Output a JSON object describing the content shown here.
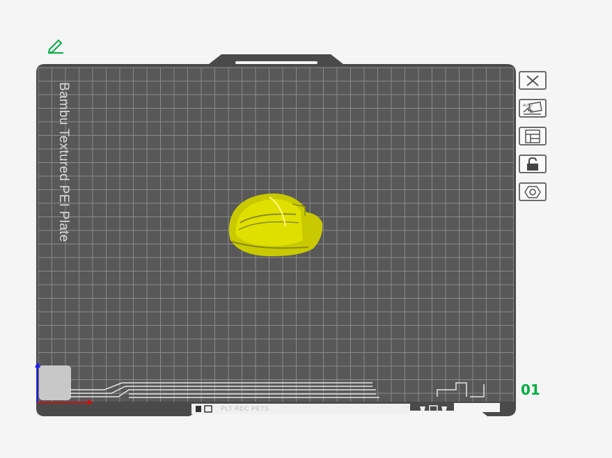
{
  "plate": {
    "name": "Bambu Textured PEI Plate",
    "index": "01",
    "bed_color": "#585858",
    "grid_color": "#8a8a8a",
    "accent_color": "#00ae42"
  },
  "toolbar": {
    "buttons": [
      {
        "name": "close-plate-button",
        "icon": "close-icon"
      },
      {
        "name": "auto-orient-button",
        "icon": "auto-orient-icon",
        "badge": "AUTO"
      },
      {
        "name": "arrange-button",
        "icon": "arrange-icon"
      },
      {
        "name": "lock-plate-button",
        "icon": "lock-icon"
      },
      {
        "name": "plate-settings-button",
        "icon": "settings-icon"
      }
    ]
  },
  "model": {
    "name": "hard-hat-model",
    "color": "#d4d400"
  },
  "bottom_bar": {
    "text": "PLT RDC PETS"
  }
}
